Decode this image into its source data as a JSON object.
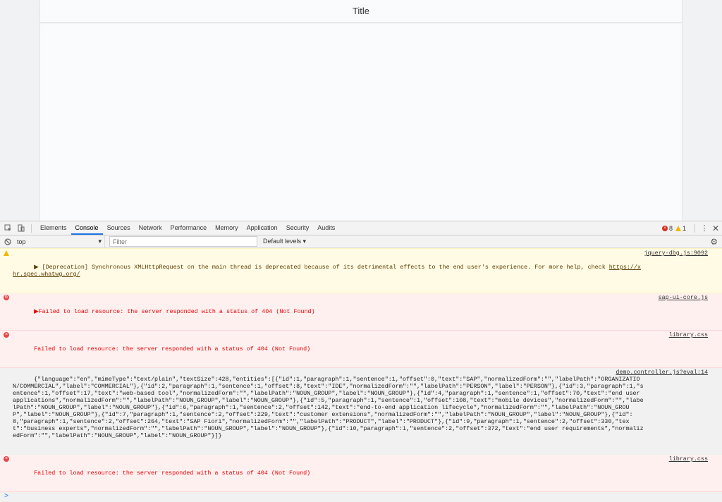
{
  "app": {
    "title": "Title"
  },
  "devtools": {
    "tabs": [
      "Elements",
      "Console",
      "Sources",
      "Network",
      "Performance",
      "Memory",
      "Application",
      "Security",
      "Audits"
    ],
    "error_count": "8",
    "warning_count": "1",
    "context": "top",
    "filter_placeholder": "Filter",
    "levels": "Default levels ▾",
    "messages": {
      "m1": {
        "text": "▶ [Deprecation] Synchronous XMLHttpRequest on the main thread is deprecated because of its detrimental effects to the end user's experience. For more help, check ",
        "link": "https://xhr.spec.whatwg.org/",
        "source": "jquery-dbg.js:9092"
      },
      "m2": {
        "badge": "6",
        "text": "▶Failed to load resource: the server responded with a status of 404 (Not Found)",
        "source": "sap-ui-core.js"
      },
      "m3": {
        "text": "Failed to load resource: the server responded with a status of 404 (Not Found)",
        "source": "library.css"
      },
      "m4": {
        "text": "{\"language\":\"en\",\"mimeType\":\"text/plain\",\"textSize\":428,\"entities\":[{\"id\":1,\"paragraph\":1,\"sentence\":1,\"offset\":0,\"text\":\"SAP\",\"normalizedForm\":\"\",\"labelPath\":\"ORGANIZATION/COMMERCIAL\",\"label\":\"COMMERCIAL\"},{\"id\":2,\"paragraph\":1,\"sentence\":1,\"offset\":8,\"text\":\"IDE\",\"normalizedForm\":\"\",\"labelPath\":\"PERSON\",\"label\":\"PERSON\"},{\"id\":3,\"paragraph\":1,\"sentence\":1,\"offset\":17,\"text\":\"web-based tool\",\"normalizedForm\":\"\",\"labelPath\":\"NOUN_GROUP\",\"label\":\"NOUN_GROUP\"},{\"id\":4,\"paragraph\":1,\"sentence\":1,\"offset\":70,\"text\":\"end user applications\",\"normalizedForm\":\"\",\"labelPath\":\"NOUN_GROUP\",\"label\":\"NOUN_GROUP\"},{\"id\":5,\"paragraph\":1,\"sentence\":1,\"offset\":108,\"text\":\"mobile devices\",\"normalizedForm\":\"\",\"labelPath\":\"NOUN_GROUP\",\"label\":\"NOUN_GROUP\"},{\"id\":6,\"paragraph\":1,\"sentence\":2,\"offset\":142,\"text\":\"end-to-end application lifecycle\",\"normalizedForm\":\"\",\"labelPath\":\"NOUN_GROUP\",\"label\":\"NOUN_GROUP\"},{\"id\":7,\"paragraph\":1,\"sentence\":2,\"offset\":229,\"text\":\"customer extensions\",\"normalizedForm\":\"\",\"labelPath\":\"NOUN_GROUP\",\"label\":\"NOUN_GROUP\"},{\"id\":8,\"paragraph\":1,\"sentence\":2,\"offset\":264,\"text\":\"SAP Fiori\",\"normalizedForm\":\"\",\"labelPath\":\"PRODUCT\",\"label\":\"PRODUCT\"},{\"id\":9,\"paragraph\":1,\"sentence\":2,\"offset\":330,\"text\":\"business experts\",\"normalizedForm\":\"\",\"labelPath\":\"NOUN_GROUP\",\"label\":\"NOUN_GROUP\"},{\"id\":10,\"paragraph\":1,\"sentence\":2,\"offset\":372,\"text\":\"end user requirements\",\"normalizedForm\":\"\",\"labelPath\":\"NOUN_GROUP\",\"label\":\"NOUN_GROUP\"}]}",
        "source": "demo.controller.js?eval:14"
      },
      "m5": {
        "text": "Failed to load resource: the server responded with a status of 404 (Not Found)",
        "source": "library.css"
      }
    },
    "prompt": ">"
  }
}
